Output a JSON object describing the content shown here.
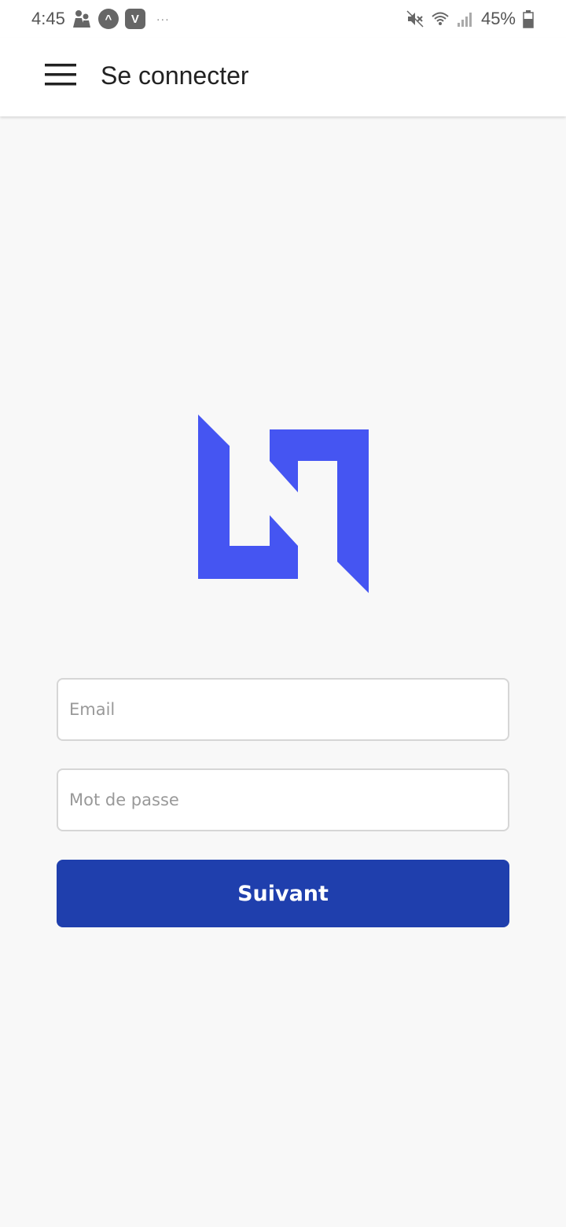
{
  "status_bar": {
    "time": "4:45",
    "badge_a": "^",
    "badge_v": "V",
    "overflow": "···",
    "battery_percent": "45%"
  },
  "app_bar": {
    "title": "Se connecter",
    "menu_icon": "hamburger-menu-icon"
  },
  "logo": {
    "color": "#4555f2"
  },
  "form": {
    "email_placeholder": "Email",
    "email_value": "",
    "password_placeholder": "Mot de passe",
    "password_value": "",
    "submit_label": "Suivant"
  },
  "colors": {
    "primary_button": "#1f3fad",
    "background": "#f8f8f8",
    "app_bar": "#ffffff"
  }
}
